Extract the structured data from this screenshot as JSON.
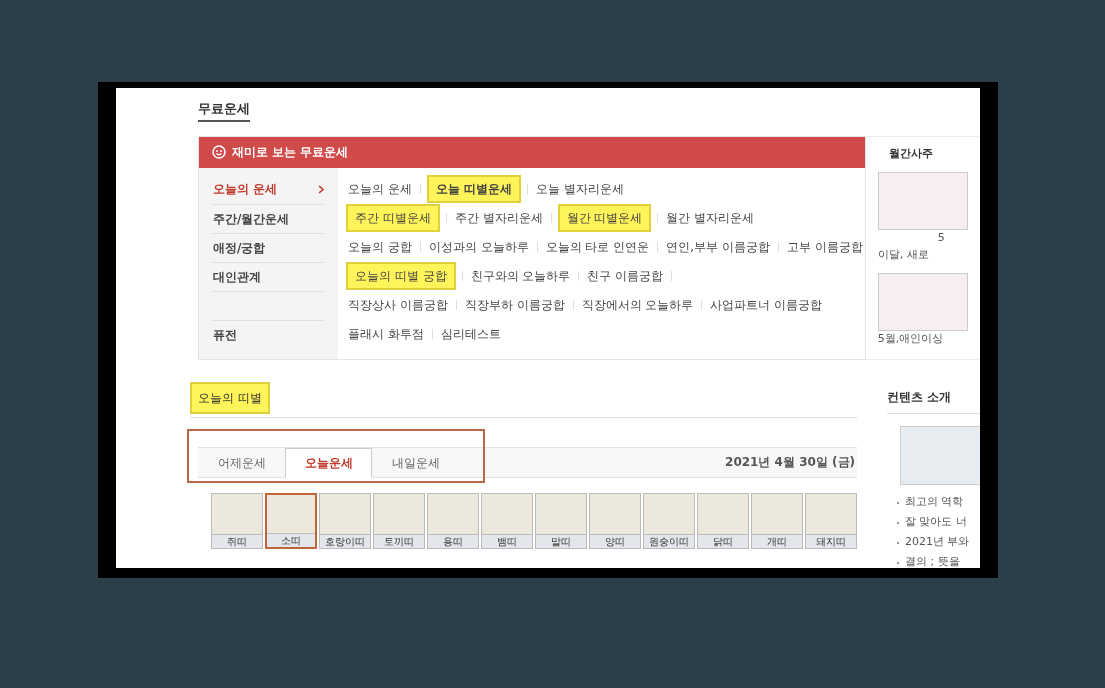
{
  "page_title": "무료운세",
  "banner": {
    "title": "재미로 보는 무료운세"
  },
  "rows": [
    {
      "menu_item": {
        "label": "오늘의 운세",
        "selected": true
      },
      "links": [
        {
          "label": "오늘의 운세",
          "highlighted": false,
          "bold": false
        },
        {
          "label": "오늘 띠별운세",
          "highlighted": true,
          "bold": true
        },
        {
          "label": "오늘 별자리운세",
          "highlighted": false,
          "bold": false
        }
      ]
    },
    {
      "menu_item": {
        "label": "주간/월간운세",
        "selected": false
      },
      "links": [
        {
          "label": "주간 띠별운세",
          "highlighted": true,
          "bold": false
        },
        {
          "label": "주간 별자리운세",
          "highlighted": false,
          "bold": false
        },
        {
          "label": "월간 띠별운세",
          "highlighted": true,
          "bold": false
        },
        {
          "label": "월간 별자리운세",
          "highlighted": false,
          "bold": false
        }
      ]
    },
    {
      "menu_item": {
        "label": "애정/궁합",
        "selected": false
      },
      "links": [
        {
          "label": "오늘의 궁합",
          "highlighted": false,
          "bold": false
        },
        {
          "label": "이성과의 오늘하루",
          "highlighted": false,
          "bold": false
        },
        {
          "label": "오늘의 타로 인연운",
          "highlighted": false,
          "bold": false
        },
        {
          "label": "연인,부부 이름궁합",
          "highlighted": false,
          "bold": false
        },
        {
          "label": "고부 이름궁합",
          "highlighted": false,
          "bold": false
        }
      ]
    },
    {
      "menu_item": {
        "label": "대인관계",
        "selected": false
      },
      "trailing_divider": true,
      "links": [
        {
          "label": "오늘의 띠별 궁합",
          "highlighted": true,
          "bold": false
        },
        {
          "label": "친구와의 오늘하루",
          "highlighted": false,
          "bold": false
        },
        {
          "label": "친구 이름궁합",
          "highlighted": false,
          "bold": false
        }
      ]
    },
    {
      "links": [
        {
          "label": "직장상사 이름궁합",
          "highlighted": false,
          "bold": false
        },
        {
          "label": "직장부하 이름궁합",
          "highlighted": false,
          "bold": false
        },
        {
          "label": "직장에서의 오늘하루",
          "highlighted": false,
          "bold": false
        },
        {
          "label": "사업파트너 이름궁합",
          "highlighted": false,
          "bold": false
        }
      ]
    },
    {
      "menu_item": {
        "label": "퓨전",
        "selected": false
      },
      "links": [
        {
          "label": "플래시 화투점",
          "highlighted": false,
          "bold": false
        },
        {
          "label": "심리테스트",
          "highlighted": false,
          "bold": false
        }
      ]
    }
  ],
  "monthly": {
    "title": "월간사주",
    "items": [
      {
        "caption_lines": [
          "5",
          "이달, 새로"
        ]
      },
      {
        "caption_lines": [
          "5월,애인이싱"
        ]
      }
    ]
  },
  "section": {
    "title": "오늘의 띠별",
    "highlighted": true,
    "tabs": [
      {
        "label": "어제운세",
        "selected": false
      },
      {
        "label": "오늘운세",
        "selected": true
      },
      {
        "label": "내일운세",
        "selected": false
      }
    ],
    "date": "2021년 4월 30일 (금)",
    "zodiac": [
      {
        "label": "쥐띠",
        "selected": false
      },
      {
        "label": "소띠",
        "selected": true
      },
      {
        "label": "호랑이띠",
        "selected": false
      },
      {
        "label": "토끼띠",
        "selected": false
      },
      {
        "label": "용띠",
        "selected": false
      },
      {
        "label": "뱀띠",
        "selected": false
      },
      {
        "label": "말띠",
        "selected": false
      },
      {
        "label": "양띠",
        "selected": false
      },
      {
        "label": "원숭이띠",
        "selected": false
      },
      {
        "label": "닭띠",
        "selected": false
      },
      {
        "label": "개띠",
        "selected": false
      },
      {
        "label": "돼지띠",
        "selected": false
      }
    ]
  },
  "contents": {
    "title": "컨텐츠 소개",
    "items": [
      "최고의 역학",
      "잘 맞아도 너",
      "2021년 부와",
      "결의 ; 뜻을"
    ]
  }
}
